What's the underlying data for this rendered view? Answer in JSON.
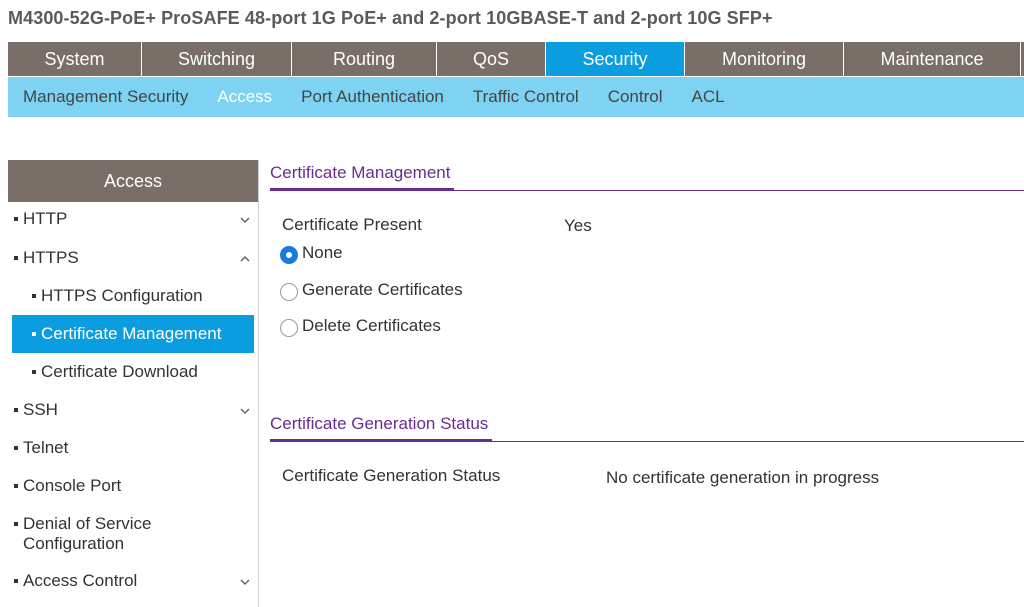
{
  "device": {
    "title": "M4300-52G-PoE+ ProSAFE 48-port 1G PoE+ and 2-port 10GBASE-T and 2-port 10G SFP+"
  },
  "main_nav": [
    {
      "label": "System",
      "active": false
    },
    {
      "label": "Switching",
      "active": false
    },
    {
      "label": "Routing",
      "active": false
    },
    {
      "label": "QoS",
      "active": false
    },
    {
      "label": "Security",
      "active": true
    },
    {
      "label": "Monitoring",
      "active": false
    },
    {
      "label": "Maintenance",
      "active": false
    }
  ],
  "sub_nav": [
    {
      "label": "Management Security",
      "active": false
    },
    {
      "label": "Access",
      "active": true
    },
    {
      "label": "Port Authentication",
      "active": false
    },
    {
      "label": "Traffic Control",
      "active": false
    },
    {
      "label": "Control",
      "active": false
    },
    {
      "label": "ACL",
      "active": false
    }
  ],
  "sidebar": {
    "header": "Access",
    "items": [
      {
        "label": "HTTP",
        "level": 0,
        "chevron": "down"
      },
      {
        "label": "HTTPS",
        "level": 0,
        "chevron": "up"
      },
      {
        "label": "HTTPS Configuration",
        "level": 1
      },
      {
        "label": "Certificate Management",
        "level": 1,
        "selected": true
      },
      {
        "label": "Certificate Download",
        "level": 1
      },
      {
        "label": "SSH",
        "level": 0,
        "chevron": "down"
      },
      {
        "label": "Telnet",
        "level": 0
      },
      {
        "label": "Console Port",
        "level": 0
      },
      {
        "label": "Denial of Service Configuration",
        "level": 0
      },
      {
        "label": "Access Control",
        "level": 0,
        "chevron": "down"
      }
    ]
  },
  "cert_mgmt": {
    "heading": "Certificate Management",
    "present_label": "Certificate Present",
    "present_value": "Yes",
    "options": [
      {
        "label": "None",
        "checked": true
      },
      {
        "label": "Generate Certificates",
        "checked": false
      },
      {
        "label": "Delete Certificates",
        "checked": false
      }
    ]
  },
  "cert_gen": {
    "heading": "Certificate Generation Status",
    "status_label": "Certificate Generation Status",
    "status_value": "No certificate generation in progress"
  },
  "colors": {
    "nav_bg": "#7a6e68",
    "nav_active": "#0a9ee0",
    "subnav_bg": "#7fd3f2",
    "section_accent": "#6a2c91",
    "radio_checked": "#1a7ae0"
  },
  "icons": {
    "chevron_down": "chevron-down-icon",
    "chevron_up": "chevron-up-icon",
    "bullet": "bullet-icon"
  }
}
